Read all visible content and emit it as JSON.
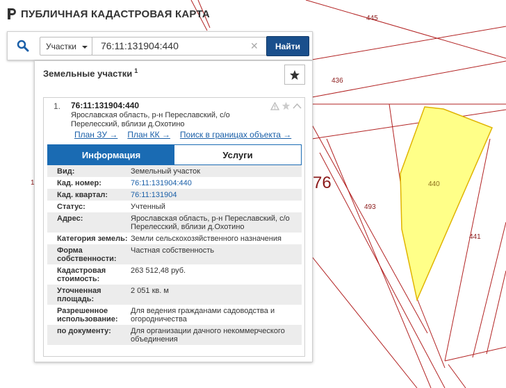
{
  "header": {
    "title": "ПУБЛИЧНАЯ КАДАСТРОВАЯ КАРТА"
  },
  "search": {
    "type_selected": "Участки",
    "query": "76:11:131904:440",
    "find_label": "Найти"
  },
  "panel": {
    "title": "Земельные участки",
    "count": "1"
  },
  "result": {
    "number": "1.",
    "cad_id": "76:11:131904:440",
    "address": "Ярославская область, р-н Переславский, с/о Перелесский, вблизи д.Охотино",
    "links": [
      "План ЗУ →",
      "План КК →",
      "Поиск в границах объекта →"
    ],
    "tabs": {
      "info": "Информация",
      "services": "Услуги"
    },
    "properties": [
      {
        "label": "Вид:",
        "value": "Земельный участок"
      },
      {
        "label": "Кад. номер:",
        "value": "76:11:131904:440"
      },
      {
        "label": "Кад. квартал:",
        "value": "76:11:131904"
      },
      {
        "label": "Статус:",
        "value": "Учтенный"
      },
      {
        "label": "Адрес:",
        "value": "Ярославская область, р-н Переславский, с/о Перелесский, вблизи д.Охотино"
      },
      {
        "label": "Категория земель:",
        "value": "Земли сельскохозяйственного назначения"
      },
      {
        "label": "Форма собственности:",
        "value": "Частная собственность"
      },
      {
        "label": "Кадастровая стоимость:",
        "value": "263 512,48 руб."
      },
      {
        "label": "Уточненная площадь:",
        "value": "2 051 кв. м"
      },
      {
        "label": "Разрешенное использование:",
        "value": "Для ведения гражданами садоводства и огородничества"
      },
      {
        "label": "по документу:",
        "value": "Для организации дачного некоммерческого объединения"
      }
    ]
  },
  "map": {
    "labels": {
      "p445": "445",
      "p436": "436",
      "p440": "440",
      "p493": "493",
      "p441": "441",
      "quarter": "76",
      "edge": "1"
    },
    "colors": {
      "parcel_border": "#b22222",
      "selected_fill": "#ffff88",
      "selected_border": "#e0b400"
    }
  }
}
